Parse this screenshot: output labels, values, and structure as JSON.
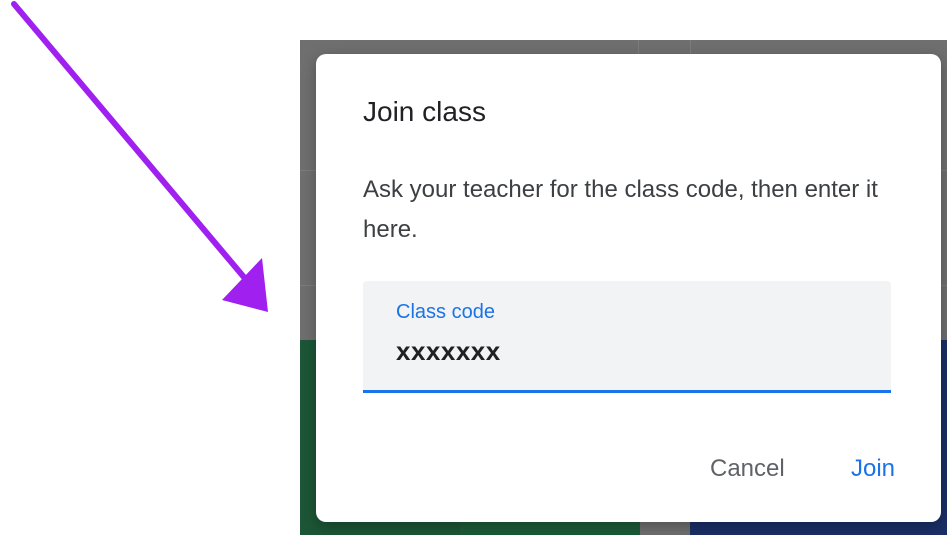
{
  "dialog": {
    "title": "Join class",
    "description": "Ask your teacher for the class code, then enter it here.",
    "class_code_field": {
      "label": "Class code",
      "value": "xxxxxxx"
    },
    "actions": {
      "cancel_label": "Cancel",
      "join_label": "Join"
    }
  },
  "colors": {
    "accent": "#1a73e8",
    "arrow": "#a020f0",
    "scrim": "#6f6f6f"
  },
  "annotation": {
    "icon": "arrow-pointer-icon"
  }
}
